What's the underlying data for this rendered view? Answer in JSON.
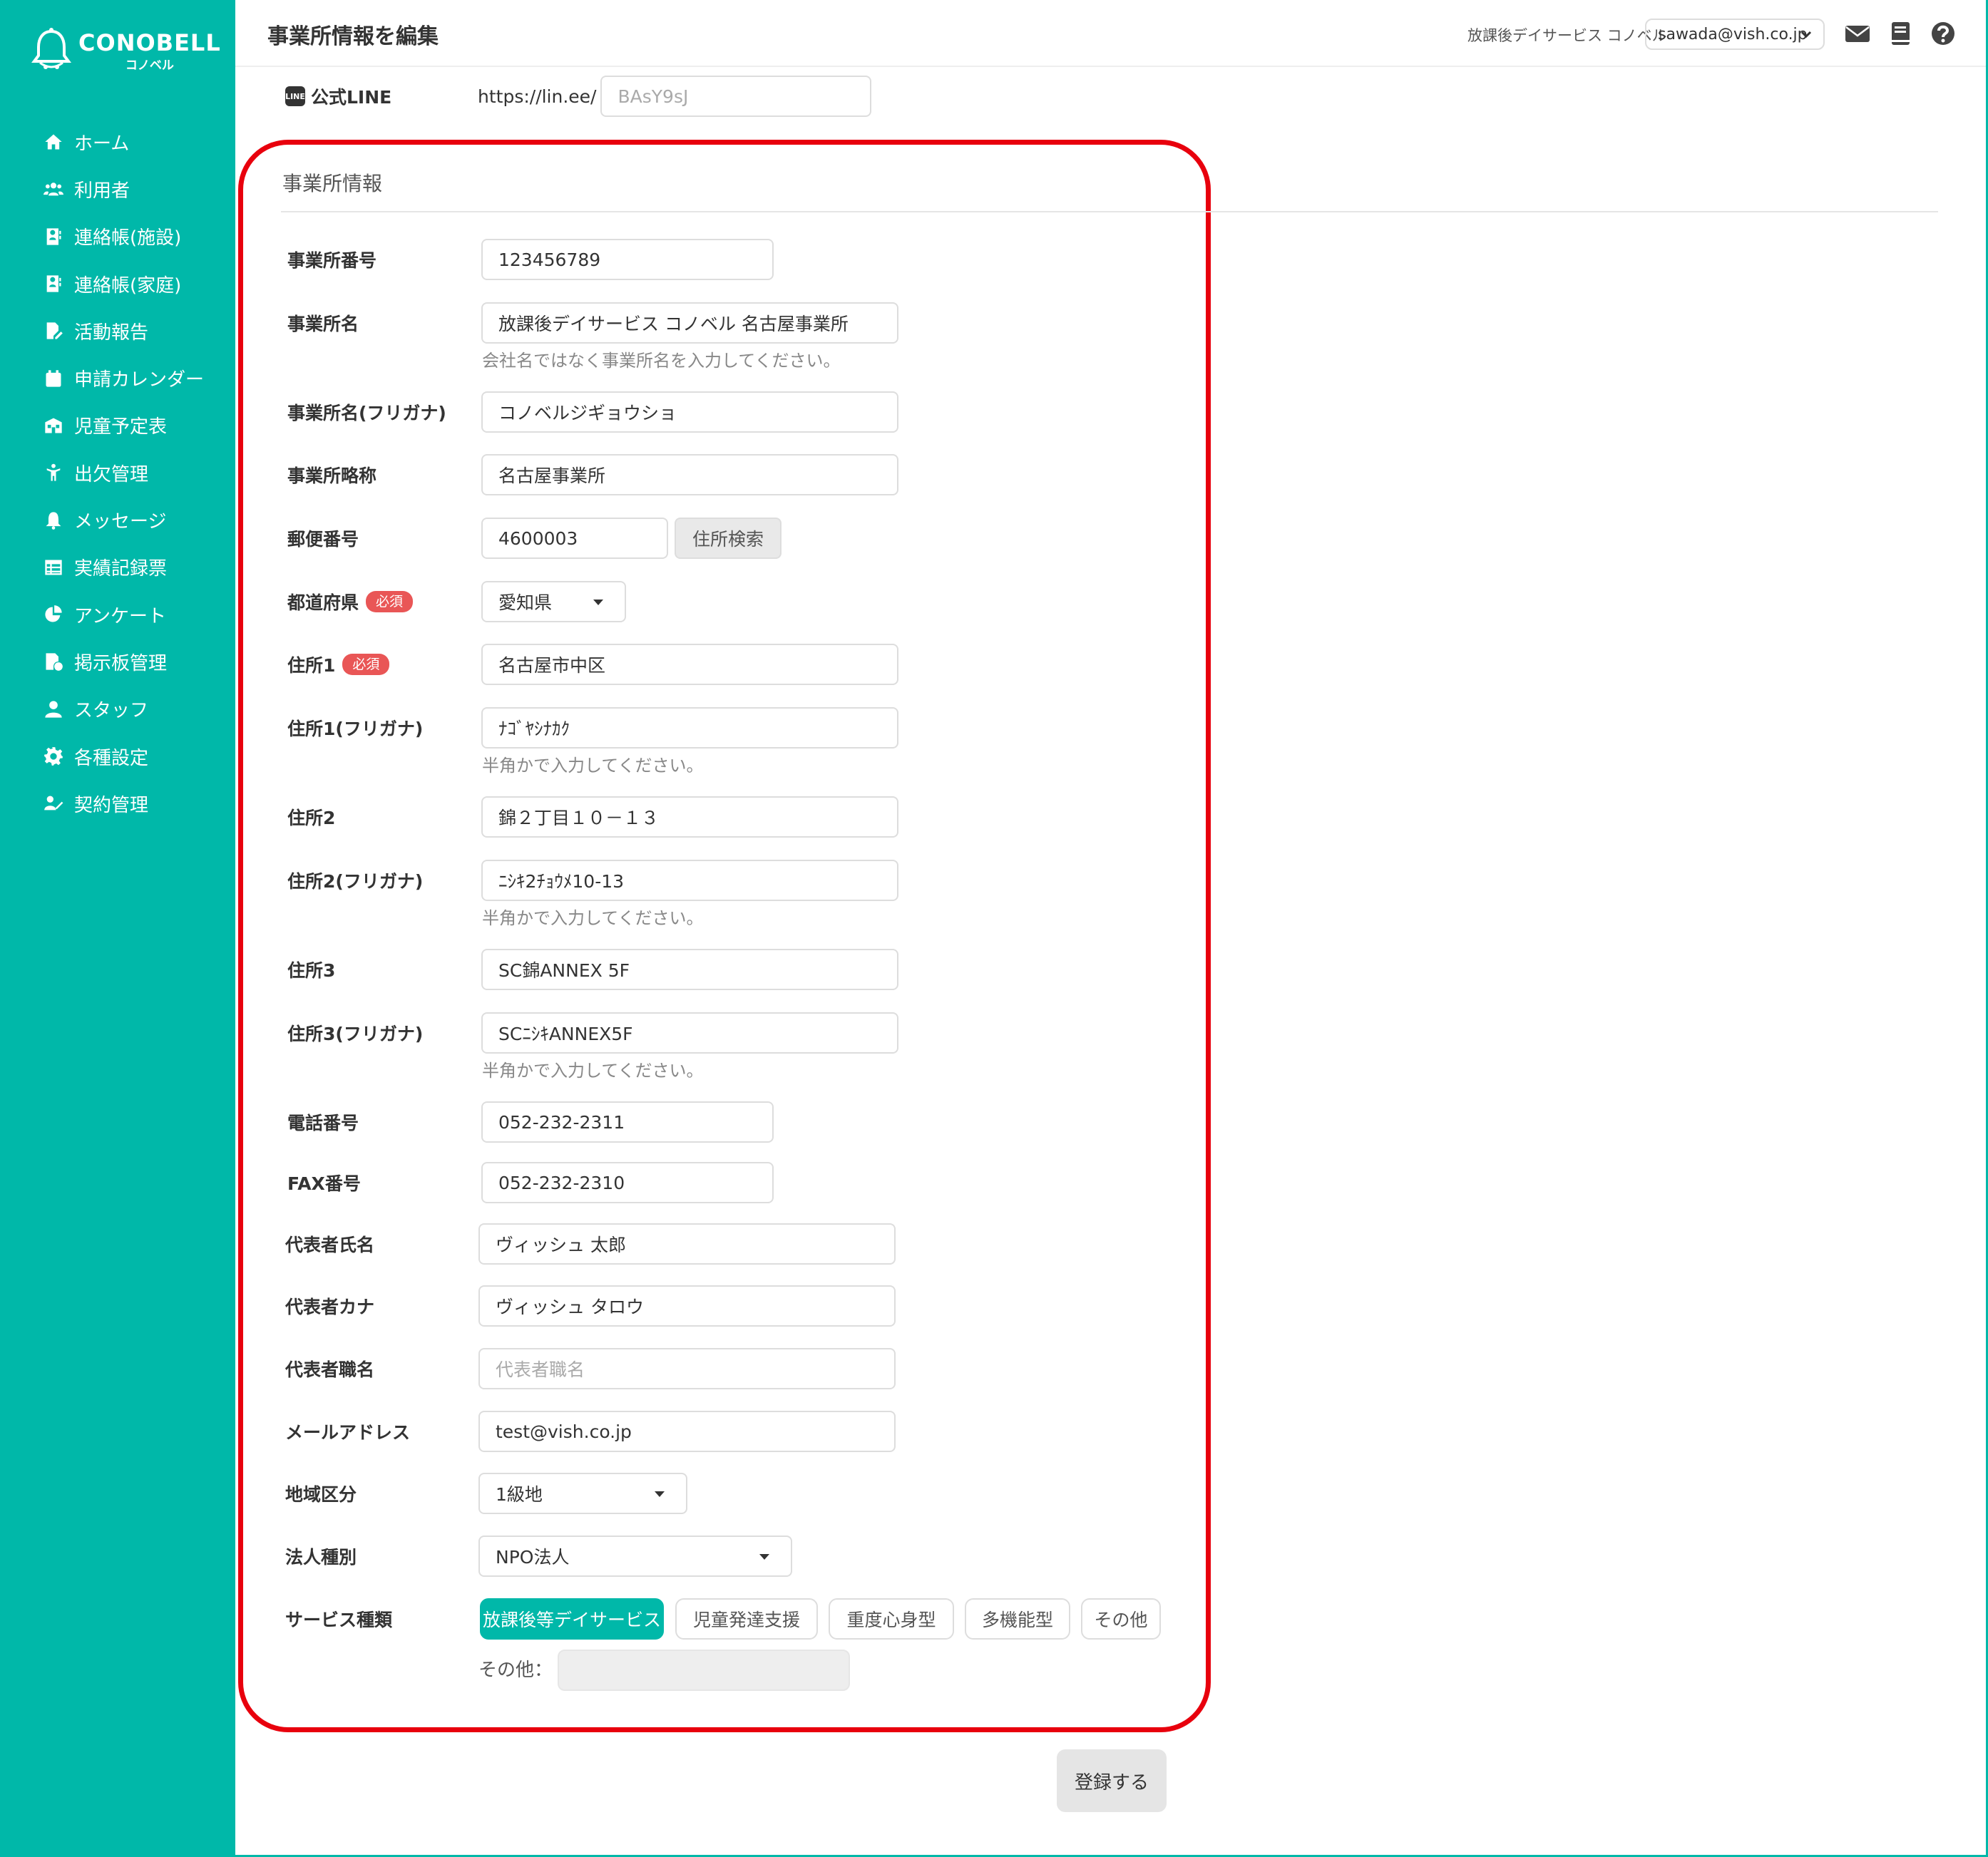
{
  "brand": {
    "name": "CONOBELL",
    "sub": "コノベル",
    "accent": "#00b8a9",
    "highlight": "#e8000d"
  },
  "sidebar": {
    "items": [
      {
        "label": "ホーム",
        "icon": "home-icon"
      },
      {
        "label": "利用者",
        "icon": "users-icon"
      },
      {
        "label": "連絡帳(施設)",
        "icon": "contact-book-icon"
      },
      {
        "label": "連絡帳(家庭)",
        "icon": "contact-book-icon"
      },
      {
        "label": "活動報告",
        "icon": "report-edit-icon"
      },
      {
        "label": "申請カレンダー",
        "icon": "calendar-icon"
      },
      {
        "label": "児童予定表",
        "icon": "schedule-icon"
      },
      {
        "label": "出欠管理",
        "icon": "attendance-icon"
      },
      {
        "label": "メッセージ",
        "icon": "bell-icon"
      },
      {
        "label": "実績記録票",
        "icon": "table-icon"
      },
      {
        "label": "アンケート",
        "icon": "pie-chart-icon"
      },
      {
        "label": "掲示板管理",
        "icon": "board-icon"
      },
      {
        "label": "スタッフ",
        "icon": "staff-icon"
      },
      {
        "label": "各種設定",
        "icon": "gear-icon"
      },
      {
        "label": "契約管理",
        "icon": "contract-icon"
      }
    ]
  },
  "header": {
    "title": "事業所情報を編集",
    "office": "放課後デイサービス コノベル",
    "account": "sawada@vish.co.jp"
  },
  "line": {
    "label": "公式LINE",
    "badge": "LINE",
    "prefix": "https://lin.ee/",
    "placeholder": "BAsY9sJ"
  },
  "section": {
    "title": "事業所情報"
  },
  "form": {
    "office_no": {
      "label": "事業所番号",
      "value": "123456789"
    },
    "office_name": {
      "label": "事業所名",
      "value": "放課後デイサービス コノベル 名古屋事業所",
      "hint": "会社名ではなく事業所名を入力してください。"
    },
    "office_kana": {
      "label": "事業所名(フリガナ)",
      "value": "コノベルジギョウショ"
    },
    "office_short": {
      "label": "事業所略称",
      "value": "名古屋事業所"
    },
    "postal": {
      "label": "郵便番号",
      "value": "4600003",
      "button": "住所検索"
    },
    "prefecture": {
      "label": "都道府県",
      "required": "必須",
      "value": "愛知県"
    },
    "address1": {
      "label": "住所1",
      "required": "必須",
      "value": "名古屋市中区"
    },
    "address1_kana": {
      "label": "住所1(フリガナ)",
      "value": "ﾅｺﾞﾔｼﾅｶｸ",
      "hint": "半角かで入力してください。"
    },
    "address2": {
      "label": "住所2",
      "value": "錦２丁目１０－１３"
    },
    "address2_kana": {
      "label": "住所2(フリガナ)",
      "value": "ﾆｼｷ2ﾁｮｳﾒ10-13",
      "hint": "半角かで入力してください。"
    },
    "address3": {
      "label": "住所3",
      "value": "SC錦ANNEX 5F"
    },
    "address3_kana": {
      "label": "住所3(フリガナ)",
      "value": "SCﾆｼｷANNEX5F",
      "hint": "半角かで入力してください。"
    },
    "phone": {
      "label": "電話番号",
      "value": "052-232-2311"
    },
    "fax": {
      "label": "FAX番号",
      "value": "052-232-2310"
    },
    "rep_name": {
      "label": "代表者氏名",
      "value": "ヴィッシュ 太郎"
    },
    "rep_kana": {
      "label": "代表者カナ",
      "value": "ヴィッシュ タロウ"
    },
    "rep_title": {
      "label": "代表者職名",
      "placeholder": "代表者職名"
    },
    "email": {
      "label": "メールアドレス",
      "value": "test@vish.co.jp"
    },
    "region": {
      "label": "地域区分",
      "value": "1級地"
    },
    "corp_type": {
      "label": "法人種別",
      "value": "NPO法人"
    },
    "service": {
      "label": "サービス種類",
      "options": [
        "放課後等デイサービス",
        "児童発達支援",
        "重度心身型",
        "多機能型",
        "その他"
      ],
      "selected": "放課後等デイサービス",
      "other_label": "その他："
    }
  },
  "submit": "登録する"
}
